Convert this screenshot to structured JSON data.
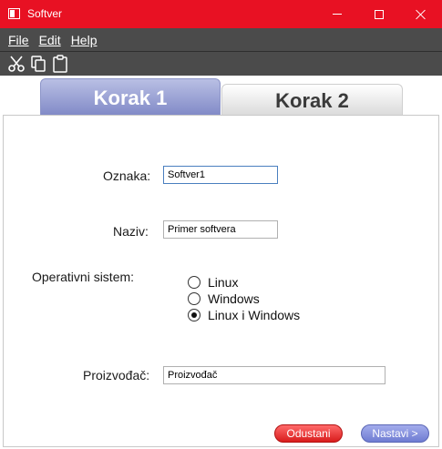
{
  "window": {
    "title": "Softver",
    "controls": {
      "minimize": "minimize-icon",
      "maximize": "maximize-icon",
      "close": "close-icon"
    }
  },
  "menu": {
    "items": [
      {
        "label": "File"
      },
      {
        "label": "Edit"
      },
      {
        "label": "Help"
      }
    ]
  },
  "toolbar": {
    "tools": [
      "cut-icon",
      "copy-icon",
      "paste-icon"
    ]
  },
  "tabs": [
    {
      "label": "Korak 1",
      "active": true
    },
    {
      "label": "Korak 2",
      "active": false
    }
  ],
  "form": {
    "oznaka": {
      "label": "Oznaka:",
      "value": "Softver1"
    },
    "naziv": {
      "label": "Naziv:",
      "value": "Primer softvera"
    },
    "os": {
      "label": "Operativni sistem:",
      "options": [
        "Linux",
        "Windows",
        "Linux i Windows"
      ],
      "selected": "Linux i Windows"
    },
    "proizvodjac": {
      "label": "Proizvođač:",
      "value": "Proizvođač"
    }
  },
  "buttons": {
    "cancel": "Odustani",
    "next": "Nastavi >"
  },
  "colors": {
    "titlebar": "#e81123",
    "menubar": "#4b4b4b",
    "active_tab": "#8f98cf",
    "cancel": "#e53232",
    "next": "#8590de"
  }
}
